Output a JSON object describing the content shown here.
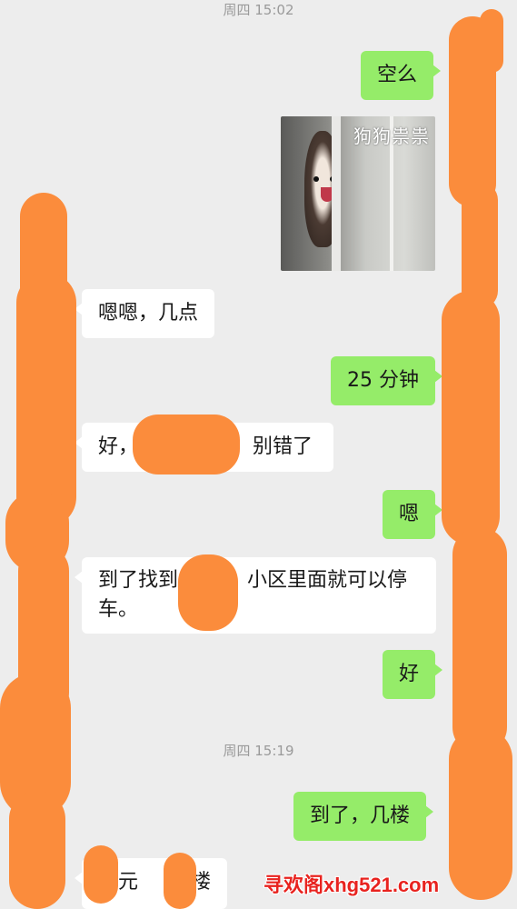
{
  "timestamps": {
    "first": "周四 15:02",
    "second": "周四 15:19"
  },
  "messages": [
    {
      "side": "out",
      "text": "空么"
    },
    {
      "side": "out",
      "sticker_caption": "狗狗祟祟"
    },
    {
      "side": "in",
      "text": "嗯嗯，几点"
    },
    {
      "side": "out",
      "text": "25 分钟"
    },
    {
      "side": "in",
      "text_a": "好，",
      "text_b": "，别错了"
    },
    {
      "side": "out",
      "text": "嗯"
    },
    {
      "side": "in",
      "text_a": "到了找到",
      "text_b": "小区里面就可以停",
      "text_c": "车。"
    },
    {
      "side": "out",
      "text": "好"
    },
    {
      "side": "out",
      "text": "到了，几楼"
    },
    {
      "side": "in",
      "text_a": "单元",
      "text_b": "楼"
    }
  ],
  "watermark": "寻欢阁xhg521.com",
  "colors": {
    "background": "#ededed",
    "outgoing_bubble": "#95ec69",
    "incoming_bubble": "#ffffff",
    "redaction": "#fb8c3c",
    "watermark": "#e8231f"
  }
}
